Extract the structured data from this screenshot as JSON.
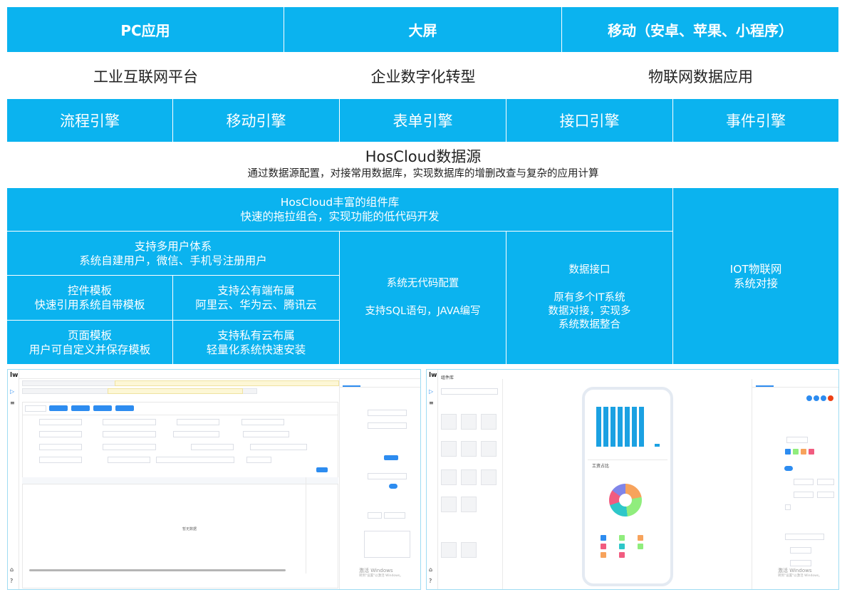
{
  "top_row": [
    "PC应用",
    "大屏",
    "移动（安卓、苹果、小程序）"
  ],
  "second_row": [
    "工业互联网平台",
    "企业数字化转型",
    "物联网数据应用"
  ],
  "engines": [
    "流程引擎",
    "移动引擎",
    "表单引擎",
    "接口引擎",
    "事件引擎"
  ],
  "datasource": {
    "title": "HosCloud数据源",
    "desc": "通过数据源配置，对接常用数据库，实现数据库的增删改查与复杂的应用计算"
  },
  "components": {
    "line1": "HosCloud丰富的组件库",
    "line2": "快速的拖拉组合，实现功能的低代码开发"
  },
  "multi_user": {
    "line1": "支持多用户体系",
    "line2": "系统自建用户，微信、手机号注册用户"
  },
  "control_template": {
    "line1": "控件模板",
    "line2": "快速引用系统自带模板"
  },
  "public_cloud": {
    "line1": "支持公有端布属",
    "line2": "阿里云、华为云、腾讯云"
  },
  "page_template": {
    "line1": "页面模板",
    "line2": "用户可自定义并保存模板"
  },
  "private_cloud": {
    "line1": "支持私有云布属",
    "line2": "轻量化系统快速安装"
  },
  "no_code": {
    "line1": "系统无代码配置",
    "line2": "支持SQL语句，JAVA编写"
  },
  "data_api": {
    "line1": "数据接口",
    "line2": "原有多个IT系统",
    "line3": "数据对接，实现多",
    "line4": "系统数据整合"
  },
  "iot": {
    "line1": "IOT物联网",
    "line2": "系统对接"
  },
  "screens": {
    "left": {
      "empty_text": "暂无数据",
      "watermark_1": "激活 Windows",
      "watermark_2": "转到\"设置\"以激活 Windows。"
    },
    "right": {
      "panel_title": "组件库",
      "chart_title": "工资占比",
      "watermark_1": "激活 Windows",
      "watermark_2": "转到\"设置\"以激活 Windows。"
    }
  },
  "colors": {
    "accent": "#0bb3ef"
  }
}
